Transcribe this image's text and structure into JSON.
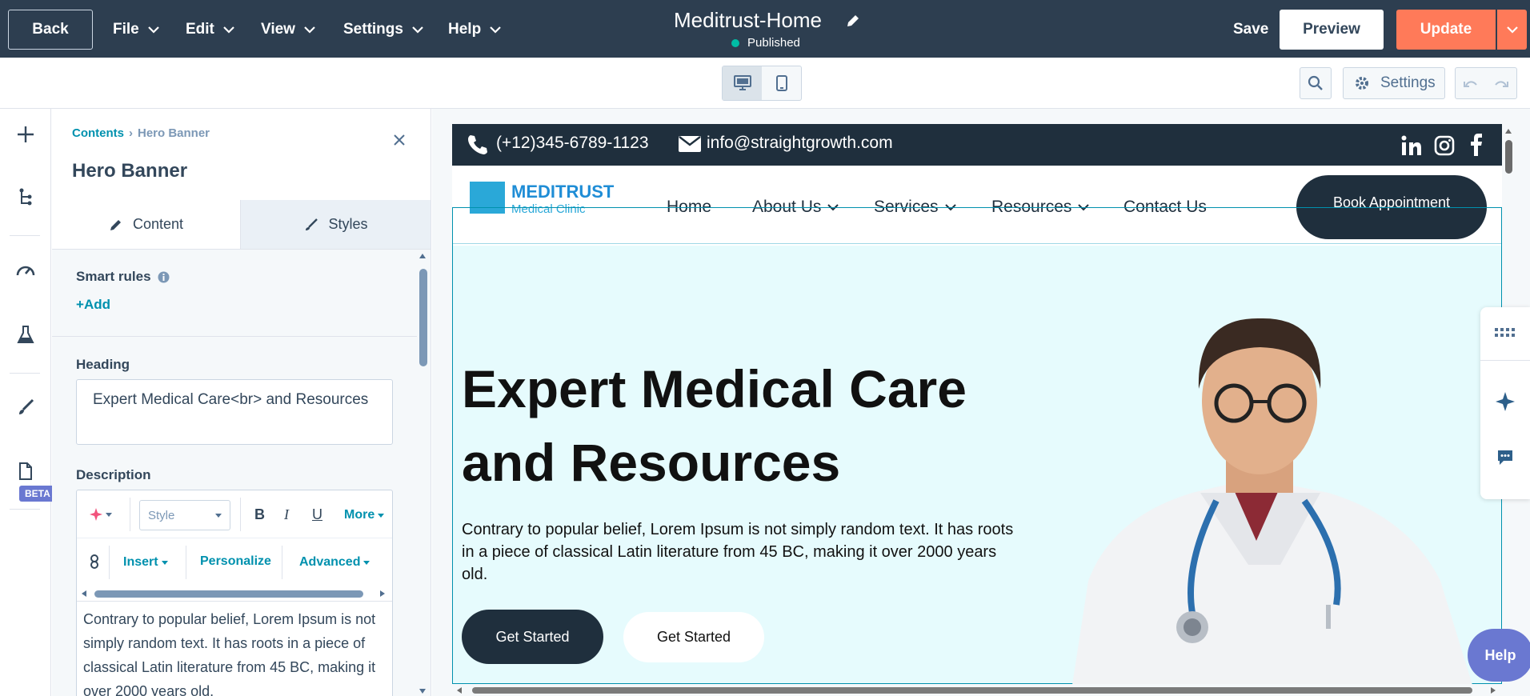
{
  "topbar": {
    "back": "Back",
    "menus": [
      "File",
      "Edit",
      "View",
      "Settings",
      "Help"
    ],
    "title": "Meditrust-Home",
    "status": "Published",
    "save": "Save",
    "preview": "Preview",
    "update": "Update"
  },
  "toolbar": {
    "settings": "Settings"
  },
  "rail": {
    "beta": "BETA"
  },
  "panel": {
    "breadcrumb_root": "Contents",
    "breadcrumb_current": "Hero Banner",
    "title": "Hero Banner",
    "tab_content": "Content",
    "tab_styles": "Styles",
    "smart_rules": "Smart rules",
    "add": "Add",
    "heading_label": "Heading",
    "heading_value": "Expert Medical Care<br> and Resources",
    "description_label": "Description",
    "rte": {
      "style": "Style",
      "bold": "B",
      "italic": "I",
      "underline": "U",
      "more": "More",
      "insert": "Insert",
      "personalize": "Personalize",
      "advanced": "Advanced"
    },
    "description_value": "Contrary to popular belief, Lorem Ipsum is not simply random text. It has roots in a piece of classical Latin literature from 45 BC, making it over 2000 years old."
  },
  "site": {
    "phone": "(+12)345-6789-1123",
    "email": "info@straightgrowth.com",
    "logo": "MEDITRUST",
    "logo_sub": "Medical Clinic",
    "nav": [
      "Home",
      "About Us",
      "Services",
      "Resources",
      "Contact Us"
    ],
    "book": "Book Appointment",
    "hero_title_1": "Expert Medical Care",
    "hero_title_2": "and Resources",
    "hero_desc": "Contrary to popular belief, Lorem Ipsum is not simply random text. It has roots in a piece of classical Latin literature from 45 BC, making it over 2000 years old.",
    "btn_primary": "Get Started",
    "btn_secondary": "Get Started"
  },
  "help": "Help",
  "colors": {
    "topbar": "#2d3e50",
    "accent": "#ff7a59",
    "link": "#0091ae",
    "hero_bg": "#e6fbfd",
    "site_dark": "#1f2f3d"
  }
}
